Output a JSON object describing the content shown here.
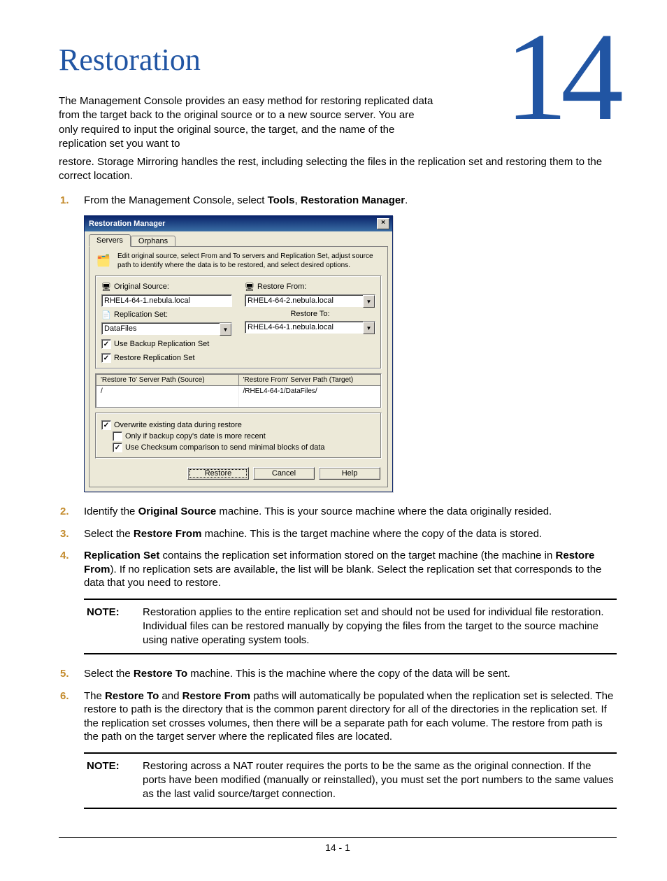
{
  "chapter": {
    "number": "14",
    "title": "Restoration"
  },
  "intro1": "The Management Console provides an easy method for restoring replicated data from the target back to the original source or to a new source server. You are only required to input the original source, the target, and the name of the replication set you want to",
  "intro2": "restore. Storage Mirroring handles the rest, including selecting the files in the replication set and restoring them to the correct location.",
  "steps": {
    "s1_a": "From the Management Console, select ",
    "s1_b": "Tools",
    "s1_c": ", ",
    "s1_d": "Restoration Manager",
    "s1_e": ".",
    "s2_a": "Identify the ",
    "s2_b": "Original Source",
    "s2_c": " machine. This is your source machine where the data originally resided.",
    "s3_a": "Select the ",
    "s3_b": "Restore From",
    "s3_c": " machine. This is the target machine where the copy of the data is stored.",
    "s4_a": "Replication Set",
    "s4_b": " contains the replication set information stored on the target machine (the machine in ",
    "s4_c": "Restore From",
    "s4_d": "). If no replication sets are available, the list will be blank. Select the replication set that corresponds to the data that you need to restore.",
    "s5_a": "Select the ",
    "s5_b": "Restore To",
    "s5_c": " machine.  This is the machine where the copy of the data will be sent.",
    "s6_a": "The ",
    "s6_b": "Restore To",
    "s6_c": " and ",
    "s6_d": "Restore From",
    "s6_e": " paths will automatically be populated when the replication set is selected. The restore to path is the directory that is the common parent directory for all of the directories in the replication set.  If the replication set crosses volumes, then there will be a separate path for each volume. The restore from path is the path on the target server where the replicated files are located."
  },
  "notes": {
    "label": "NOTE:",
    "n1": "Restoration applies to the entire replication set and should not be used for individual file restoration. Individual files can be restored manually by copying the files from the target to the source machine using native operating system tools.",
    "n2": "Restoring across a NAT router requires the ports to be the same as the original connection. If the ports have been modified (manually or reinstalled), you must set the port numbers to the same values as the last valid source/target connection."
  },
  "footer": "14 - 1",
  "dialog": {
    "title": "Restoration Manager",
    "close_glyph": "×",
    "tabs": {
      "servers": "Servers",
      "orphans": "Orphans"
    },
    "hint": "Edit original source, select From and To servers and Replication Set, adjust source path to identify where the data is to be restored, and select desired options.",
    "labels": {
      "original_source": "Original Source:",
      "replication_set": "Replication Set:",
      "restore_from": "Restore From:",
      "restore_to": "Restore To:",
      "use_backup_repset": "Use Backup Replication Set",
      "restore_repset": "Restore Replication Set",
      "path_source_hdr": "'Restore To' Server Path (Source)",
      "path_target_hdr": "'Restore From' Server Path (Target)",
      "overwrite": "Overwrite existing data during restore",
      "only_if_recent": "Only if backup copy's date is more recent",
      "checksum": "Use Checksum comparison to send minimal blocks of data"
    },
    "values": {
      "original_source": "RHEL4-64-1.nebula.local",
      "replication_set": "DataFiles",
      "restore_from": "RHEL4-64-2.nebula.local",
      "restore_to": "RHEL4-64-1.nebula.local",
      "path_source": "/",
      "path_target": "/RHEL4-64-1/DataFiles/",
      "chk_use_backup": "✓",
      "chk_restore_repset": "✓",
      "chk_overwrite": "✓",
      "chk_only_if_recent": "",
      "chk_checksum": "✓"
    },
    "buttons": {
      "restore": "Restore",
      "cancel": "Cancel",
      "help": "Help"
    },
    "dropdown_glyph": "▼"
  }
}
